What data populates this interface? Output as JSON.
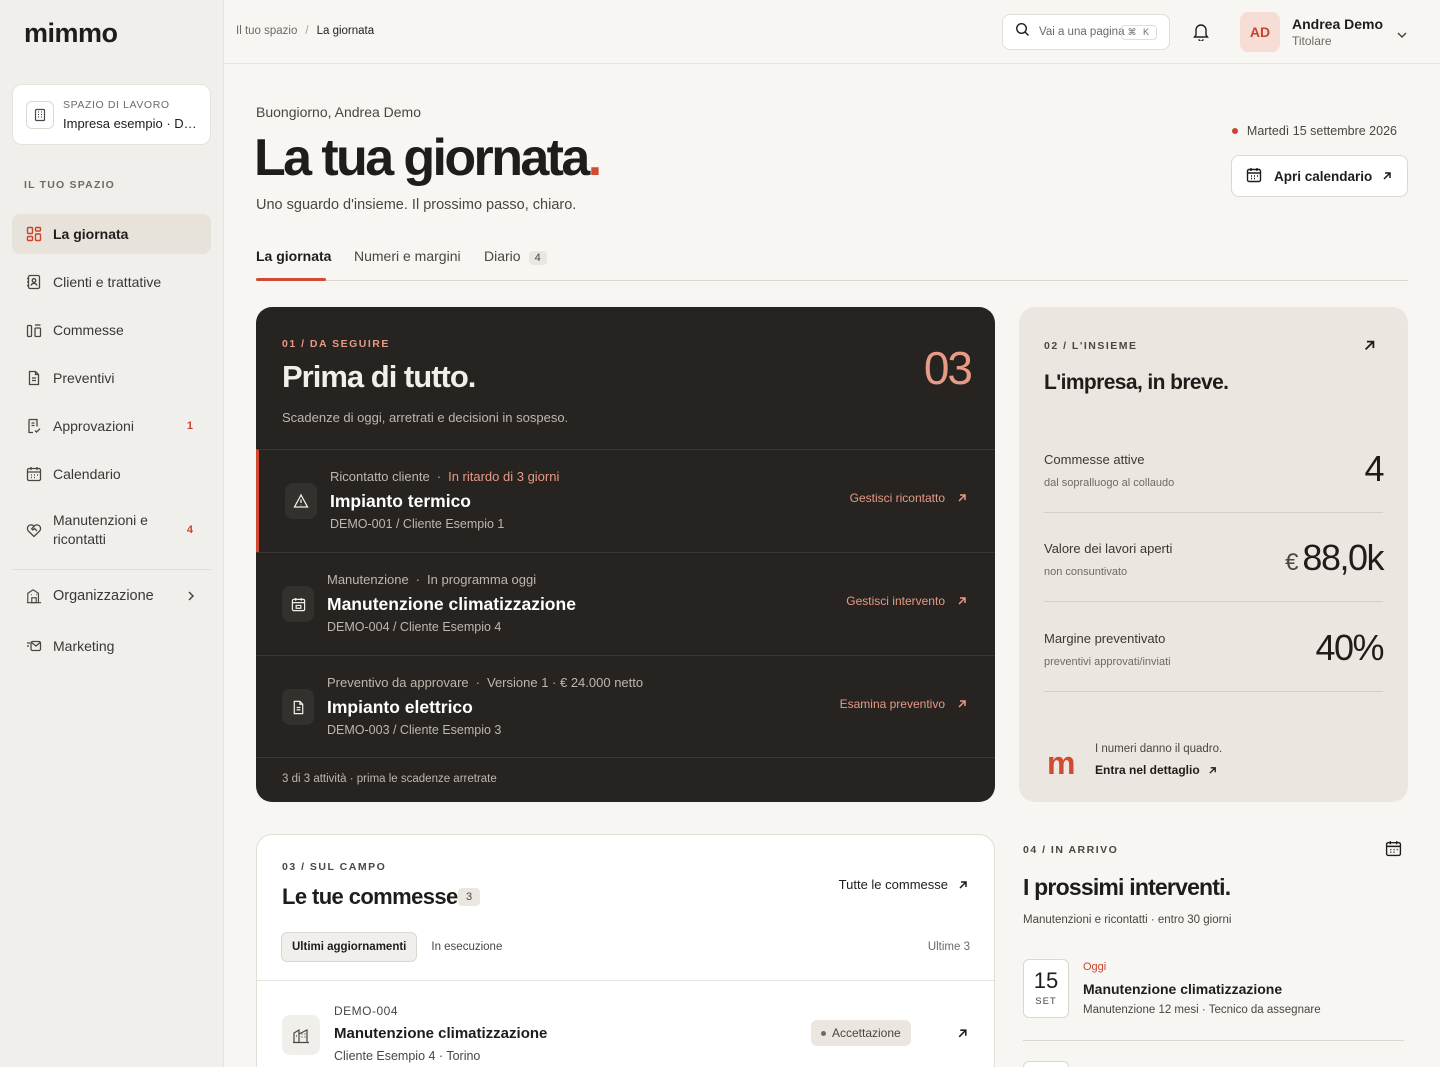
{
  "app": {
    "logo": "mimmo"
  },
  "workspace": {
    "kicker": "SPAZIO DI LAVORO",
    "name": "Impresa esempio · Demo"
  },
  "sidebar": {
    "section": "IL TUO SPAZIO",
    "items": [
      {
        "label": "La giornata",
        "icon": "grid-icon",
        "active": true
      },
      {
        "label": "Clienti e trattative",
        "icon": "contacts-icon"
      },
      {
        "label": "Commesse",
        "icon": "jobs-icon"
      },
      {
        "label": "Preventivi",
        "icon": "document-icon"
      },
      {
        "label": "Approvazioni",
        "icon": "approval-icon",
        "badge": "1"
      },
      {
        "label": "Calendario",
        "icon": "calendar-icon"
      },
      {
        "label": "Manutenzioni e ricontatti",
        "icon": "heart-handshake-icon",
        "badge": "4"
      },
      {
        "label": "Organizzazione",
        "icon": "building-icon"
      },
      {
        "label": "Marketing",
        "icon": "megaphone-icon"
      }
    ]
  },
  "topbar": {
    "breadcrumb": [
      "Il tuo spazio",
      "La giornata"
    ],
    "search_placeholder": "Vai a una pagina",
    "search_shortcut": "⌘ K",
    "user": {
      "initials": "AD",
      "name": "Andrea Demo",
      "role": "Titolare"
    }
  },
  "header": {
    "greeting": "Buongiorno, Andrea Demo",
    "title": "La tua giornata",
    "title_dot": ".",
    "subtitle": "Uno sguardo d'insieme. Il prossimo passo, chiaro.",
    "date": "Martedì 15 settembre 2026",
    "calendar_button": "Apri calendario"
  },
  "tabs": [
    {
      "label": "La giornata",
      "active": true
    },
    {
      "label": "Numeri e margini"
    },
    {
      "label": "Diario",
      "badge": "4"
    }
  ],
  "focus": {
    "kicker": "01 / DA SEGUIRE",
    "title": "Prima di tutto.",
    "count": "03",
    "description": "Scadenze di oggi, arretrati e decisioni in sospeso.",
    "tasks": [
      {
        "type": "Ricontatto cliente",
        "status": "In ritardo di 3 giorni",
        "title": "Impianto termico",
        "ref": "DEMO-001 / Cliente Esempio 1",
        "action": "Gestisci ricontatto",
        "icon": "warning-icon"
      },
      {
        "type": "Manutenzione",
        "status": "In programma oggi",
        "title": "Manutenzione climatizzazione",
        "ref": "DEMO-004 / Cliente Esempio 4",
        "action": "Gestisci intervento",
        "icon": "calendar-icon"
      },
      {
        "type": "Preventivo da approvare",
        "status": "Versione 1 · € 24.000 netto",
        "title": "Impianto elettrico",
        "ref": "DEMO-003 / Cliente Esempio 3",
        "action": "Esamina preventivo",
        "icon": "document-icon"
      }
    ],
    "footer": "3 di 3 attività · prima le scadenze arretrate"
  },
  "overview": {
    "kicker": "02 / L'INSIEME",
    "title": "L'impresa, in breve.",
    "metrics": [
      {
        "label": "Commesse attive",
        "sub": "dal sopralluogo al collaudo",
        "value": "4",
        "currency": ""
      },
      {
        "label": "Valore dei lavori aperti",
        "sub": "non consuntivato",
        "value": "88,0k",
        "currency": "€"
      },
      {
        "label": "Margine preventivato",
        "sub": "preventivi approvati/inviati",
        "value": "40%",
        "currency": ""
      }
    ],
    "brand_mark": "m",
    "note": "I numeri danno il quadro.",
    "link": "Entra nel dettaglio"
  },
  "jobs": {
    "kicker": "03 / SUL CAMPO",
    "title": "Le tue commesse",
    "count": "3",
    "all_link": "Tutte le commesse",
    "filters": [
      "Ultimi aggiornamenti",
      "In esecuzione"
    ],
    "range": "Ultime 3",
    "rows": [
      {
        "code": "DEMO-004",
        "title": "Manutenzione climatizzazione",
        "client": "Cliente Esempio 4 · Torino",
        "status": "Accettazione"
      }
    ]
  },
  "upcoming": {
    "kicker": "04 / IN ARRIVO",
    "title": "I prossimi interventi.",
    "subtitle": "Manutenzioni e ricontatti · entro 30 giorni",
    "events": [
      {
        "day": "15",
        "month": "SET",
        "tag": "Oggi",
        "title": "Manutenzione climatizzazione",
        "detail": "Manutenzione 12 mesi · Tecnico da assegnare"
      }
    ]
  }
}
